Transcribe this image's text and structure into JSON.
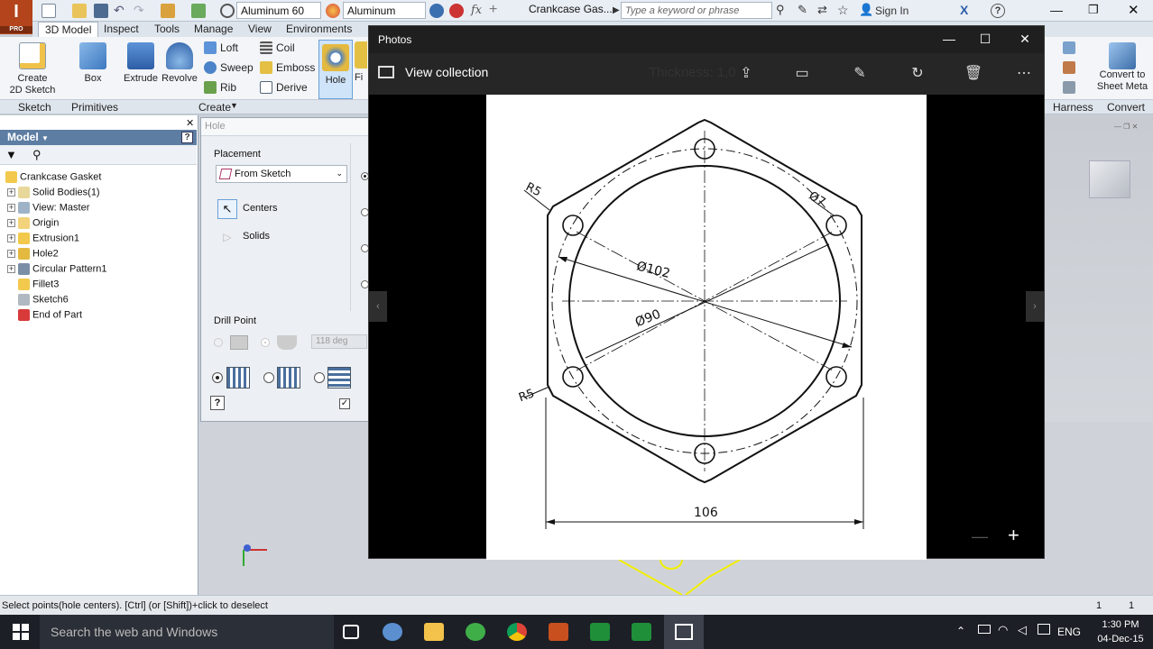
{
  "app": {
    "logo_letter": "I",
    "logo_sub": "PRO",
    "material": "Aluminum 60",
    "appearance": "Aluminum",
    "document_title": "Crankcase Gas...",
    "search_placeholder": "Type a keyword or phrase",
    "sign_in": "Sign In"
  },
  "tabs": [
    "3D Model",
    "Inspect",
    "Tools",
    "Manage",
    "View",
    "Environments"
  ],
  "ribbon": {
    "create_sketch": "Create\n2D Sketch",
    "box": "Box",
    "extrude": "Extrude",
    "revolve": "Revolve",
    "loft": "Loft",
    "sweep": "Sweep",
    "rib": "Rib",
    "coil": "Coil",
    "emboss": "Emboss",
    "derive": "Derive",
    "hole": "Hole",
    "fi": "Fi",
    "convert": "Convert to\nSheet Meta",
    "groups": {
      "sketch": "Sketch",
      "primitives": "Primitives",
      "create": "Create",
      "harness": "Harness",
      "convert": "Convert"
    }
  },
  "model": {
    "header": "Model",
    "tree": [
      {
        "label": "Crankcase Gasket",
        "expand": "",
        "color": "#f2c94c"
      },
      {
        "label": "Solid Bodies(1)",
        "expand": "+",
        "color": "#e8d79a"
      },
      {
        "label": "View: Master",
        "expand": "+",
        "color": "#9fb3c8"
      },
      {
        "label": "Origin",
        "expand": "+",
        "color": "#f2d27a"
      },
      {
        "label": "Extrusion1",
        "expand": "+",
        "color": "#f2c94c"
      },
      {
        "label": "Hole2",
        "expand": "+",
        "color": "#e4b93f"
      },
      {
        "label": "Circular Pattern1",
        "expand": "+",
        "color": "#7a8fa6"
      },
      {
        "label": "Fillet3",
        "expand": "",
        "color": "#f2c94c"
      },
      {
        "label": "Sketch6",
        "expand": "",
        "color": "#b0b8c2"
      },
      {
        "label": "End of Part",
        "expand": "",
        "color": "#d83a3a"
      }
    ]
  },
  "hole_dialog": {
    "title": "Hole",
    "placement_label": "Placement",
    "placement_value": "From Sketch",
    "centers": "Centers",
    "solids": "Solids",
    "drill_point": "Drill Point",
    "angle": "118 deg"
  },
  "status": {
    "message": "Select points(hole centers). [Ctrl] (or [Shift])+click to deselect",
    "count1": "1",
    "count2": "1"
  },
  "photos": {
    "title": "Photos",
    "view_collection": "View collection",
    "overlay_text": "Thickness: 1,0"
  },
  "drawing": {
    "r5_top": "R5",
    "r5_bottom": "R5",
    "d102": "Ø102",
    "d90": "Ø90",
    "d7": "Ø7",
    "width": "106"
  },
  "taskbar": {
    "search": "Search the web and Windows",
    "lang": "ENG",
    "time": "1:30 PM",
    "date": "04-Dec-15"
  }
}
